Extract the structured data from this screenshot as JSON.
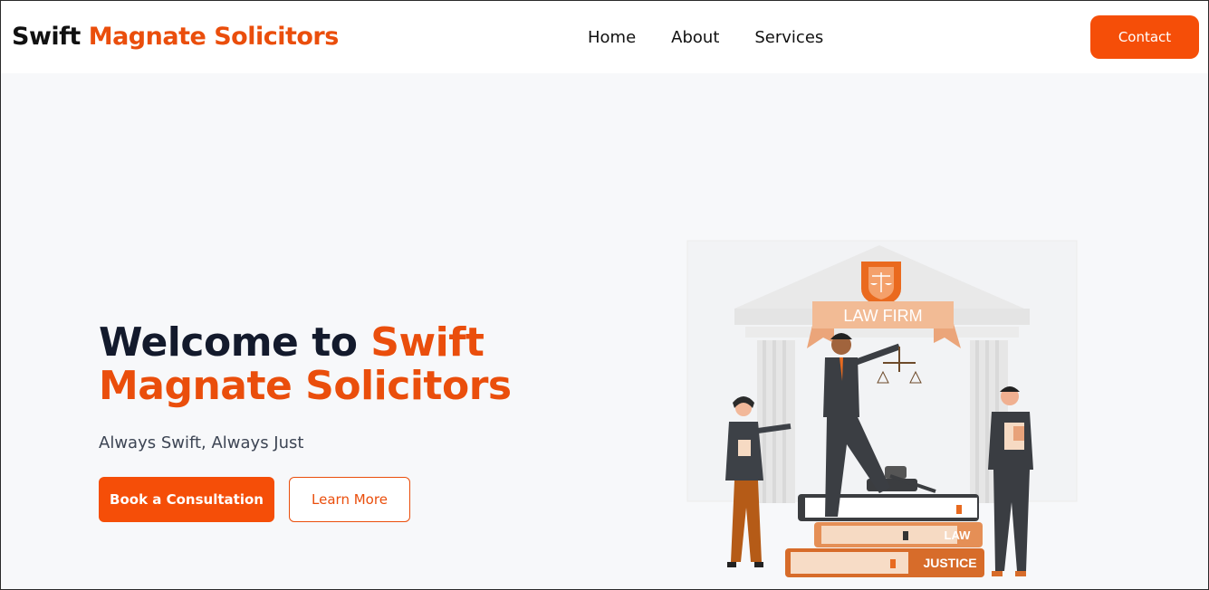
{
  "navbar": {
    "brand_part1": "Swift",
    "brand_part2": "Magnate Solicitors",
    "links": [
      "Home",
      "About",
      "Services"
    ],
    "contact_label": "Contact"
  },
  "hero": {
    "title_part1": "Welcome to",
    "title_part2": "Swift",
    "title_part3": "Magnate Solicitors",
    "tagline": "Always Swift, Always Just",
    "primary_button": "Book a Consultation",
    "secondary_button": "Learn More"
  },
  "illustration": {
    "banner_text": "LAW FIRM",
    "book_label_1": "LAW",
    "book_label_2": "JUSTICE",
    "icon": "scales-of-justice-icon"
  },
  "colors": {
    "accent": "#f54e08",
    "accent_text": "#ea4e0c",
    "heading_dark": "#131a2c",
    "background": "#f7f8fa"
  }
}
